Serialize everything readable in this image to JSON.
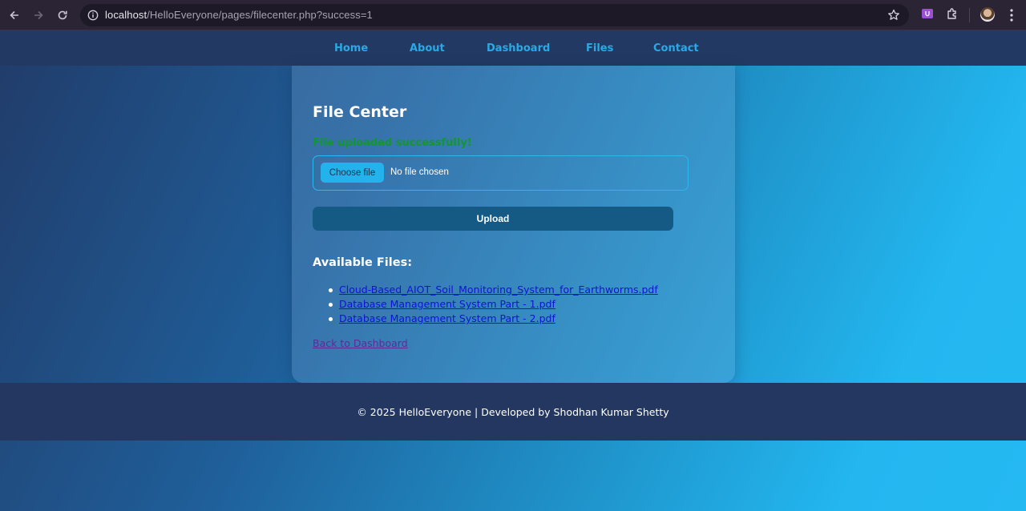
{
  "browser": {
    "url_host": "localhost",
    "url_path": "/HelloEveryone/pages/filecenter.php?success=1"
  },
  "nav": {
    "items": [
      "Home",
      "About",
      "Dashboard",
      "Files",
      "Contact"
    ]
  },
  "main": {
    "title": "File Center",
    "success_message": "File uploaded successfully!",
    "file_input": {
      "button_label": "Choose file",
      "status": "No file chosen"
    },
    "upload_label": "Upload",
    "files_heading": "Available Files:",
    "files": [
      "Cloud-Based_AIOT_Soil_Monitoring_System_for_Earthworms.pdf",
      "Database Management System Part - 1.pdf",
      "Database Management System Part - 2.pdf"
    ],
    "back_link": "Back to Dashboard"
  },
  "footer": {
    "text": "© 2025 HelloEveryone | Developed by Shodhan Kumar Shetty"
  },
  "colors": {
    "nav_link": "#29a9e6",
    "success": "#14962f",
    "upload_button": "#145a85",
    "file_link": "#0d14d8",
    "visited_link": "#5b2c9a"
  },
  "icons": [
    "back-arrow-icon",
    "forward-arrow-icon",
    "reload-icon",
    "site-info-icon",
    "bookmark-star-icon",
    "extension-icon",
    "puzzle-icon",
    "profile-avatar",
    "menu-kebab-icon"
  ]
}
